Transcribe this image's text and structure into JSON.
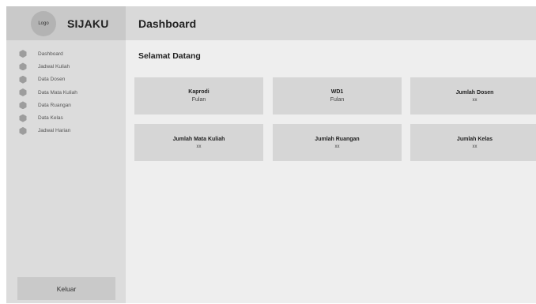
{
  "sidebar": {
    "logo_text": "Logo",
    "app_name": "SIJAKU",
    "items": [
      {
        "label": "Dashboard"
      },
      {
        "label": "Jadwal Kuliah"
      },
      {
        "label": "Data Dosen"
      },
      {
        "label": "Data Mata Kuliah"
      },
      {
        "label": "Data Ruangan"
      },
      {
        "label": "Data Kelas"
      },
      {
        "label": "Jadwal Harian"
      }
    ],
    "logout_label": "Keluar"
  },
  "header": {
    "title": "Dashboard"
  },
  "main": {
    "welcome": "Selamat Datang",
    "cards": [
      {
        "title": "Kaprodi",
        "value": "Fulan"
      },
      {
        "title": "WD1",
        "value": "Fulan"
      },
      {
        "title": "Jumlah Dosen",
        "value": "xx"
      },
      {
        "title": "Jumlah Mata Kuliah",
        "value": "xx"
      },
      {
        "title": "Jumlah Ruangan",
        "value": "xx"
      },
      {
        "title": "Jumlah Kelas",
        "value": "xx"
      }
    ]
  },
  "colors": {
    "sidebar_bg": "#dcdcdc",
    "header_bg": "#d9d9d9",
    "content_bg": "#eeeeee",
    "card_bg": "#d6d6d6",
    "icon_fill": "#9d9d9d"
  },
  "icons": {
    "logo": "circle-logo-placeholder",
    "nav_item": "hexagon-icon"
  }
}
